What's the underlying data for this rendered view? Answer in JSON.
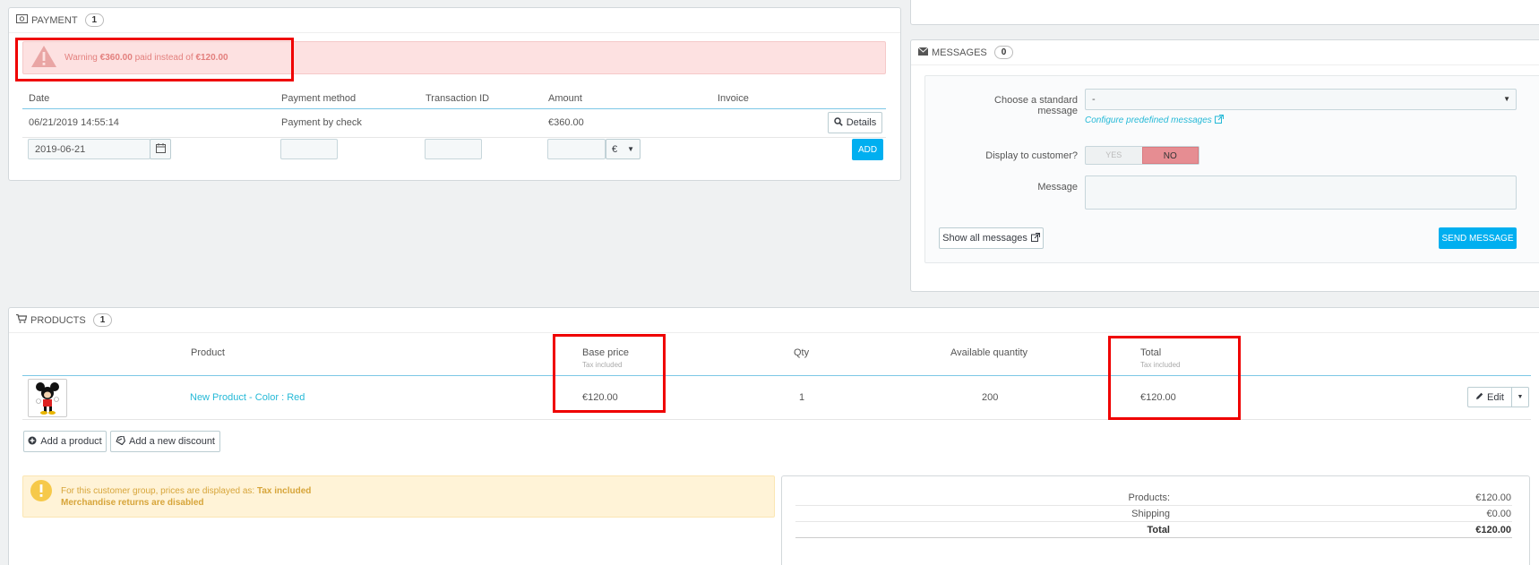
{
  "payment": {
    "title": "PAYMENT",
    "count": "1",
    "warning_prefix": "Warning",
    "warning_paid": "€360.00",
    "warning_mid": "paid instead of",
    "warning_expected": "€120.00",
    "columns": [
      "Date",
      "Payment method",
      "Transaction ID",
      "Amount",
      "Invoice"
    ],
    "row": {
      "date": "06/21/2019 14:55:14",
      "method": "Payment by check",
      "amount": "€360.00",
      "details_label": "Details"
    },
    "new_date_value": "2019-06-21",
    "currency": "€",
    "add_label": "ADD"
  },
  "messages": {
    "title": "MESSAGES",
    "count": "0",
    "choose_label": "Choose a standard message",
    "choose_value": "-",
    "configure_link": "Configure predefined messages",
    "display_label": "Display to customer?",
    "yes_label": "YES",
    "no_label": "NO",
    "message_label": "Message",
    "show_all_label": "Show all messages",
    "send_label": "SEND MESSAGE"
  },
  "products": {
    "title": "PRODUCTS",
    "count": "1",
    "columns": {
      "product": "Product",
      "base_price": "Base price",
      "base_price_sub": "Tax included",
      "qty": "Qty",
      "available": "Available quantity",
      "total": "Total",
      "total_sub": "Tax included"
    },
    "row": {
      "name": "New Product - Color : Red",
      "base_price": "€120.00",
      "qty": "1",
      "available": "200",
      "total": "€120.00",
      "edit_label": "Edit"
    },
    "add_product_label": "Add a product",
    "add_discount_label": "Add a new discount",
    "notice_prefix": "For this customer group, prices are displayed as:",
    "notice_tax": "Tax included",
    "notice_returns": "Merchandise returns are disabled",
    "summary": {
      "products_label": "Products:",
      "products_value": "€120.00",
      "shipping_label": "Shipping",
      "shipping_value": "€0.00",
      "total_label": "Total",
      "total_value": "€120.00"
    }
  },
  "colors": {
    "accent": "#00aff0",
    "highlight": "#ef0000",
    "danger_bg": "#fde1e1",
    "warning_bg": "#fff3d7"
  }
}
